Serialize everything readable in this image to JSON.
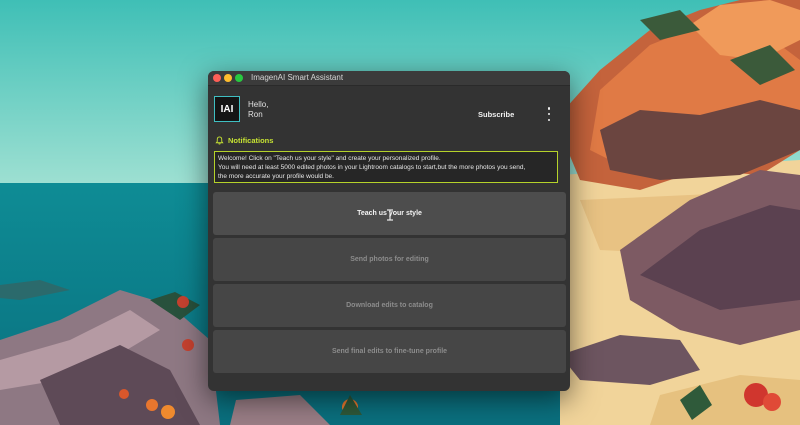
{
  "window": {
    "title": "ImagenAI Smart Assistant"
  },
  "header": {
    "logo_text": "IAI",
    "greeting_line1": "Hello,",
    "greeting_line2": "Ron",
    "subscribe_label": "Subscribe",
    "menu_icon": "kebab-menu-icon"
  },
  "notifications": {
    "label": "Notifications",
    "icon": "bell-icon",
    "message_lines": [
      "Welcome! Click on \"Teach us your style\" and create your personalized profile.",
      "You will need at least 5000 edited photos in your Lightroom catalogs to start,but the more photos you send,",
      "the more accurate your profile would be."
    ]
  },
  "actions": [
    {
      "label": "Teach us your style",
      "enabled": true
    },
    {
      "label": "Send photos for editing",
      "enabled": false
    },
    {
      "label": "Download edits to catalog",
      "enabled": false
    },
    {
      "label": "Send final edits to fine-tune profile",
      "enabled": false
    }
  ],
  "colors": {
    "accent_green": "#c6e233",
    "logo_border": "#3fbfc2",
    "window_bg": "#333333"
  }
}
